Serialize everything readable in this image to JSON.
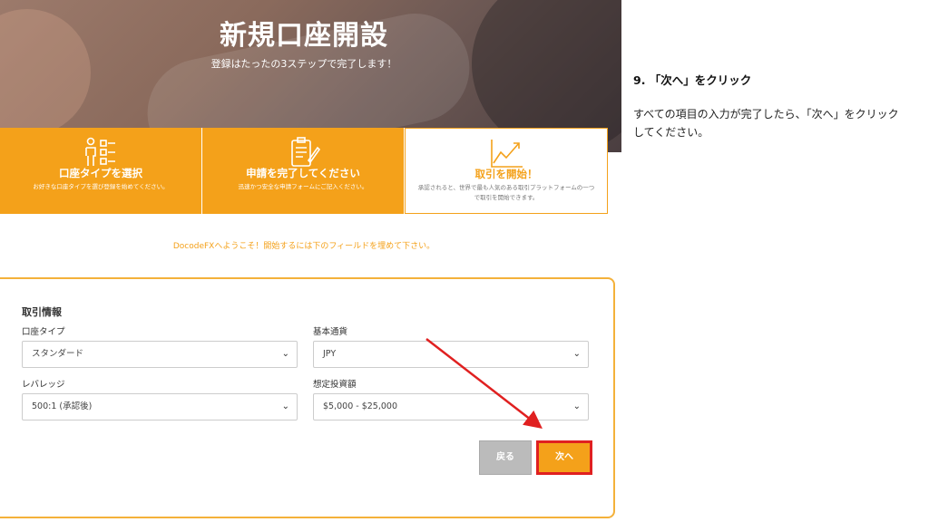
{
  "hero": {
    "title": "新規口座開設",
    "subtitle": "登録はたったの3ステップで完了します！"
  },
  "steps": [
    {
      "icon": "person-list-icon",
      "title": "口座タイプを選択",
      "desc": "お好きな口座タイプを選び登録を始めてください。",
      "active": false
    },
    {
      "icon": "clipboard-pen-icon",
      "title": "申請を完了してください",
      "desc": "迅速かつ安全な申請フォームにご記入ください。",
      "active": false
    },
    {
      "icon": "growth-chart-icon",
      "title": "取引を開始！",
      "desc": "承認されると、世界で最も人気のある取引プラットフォームの一つで取引を開始できます。",
      "active": true
    }
  ],
  "welcome": "DocodeFXへようこそ！開始するには下のフィールドを埋めて下さい。",
  "form": {
    "section_title": "取引情報",
    "account_type": {
      "label": "口座タイプ",
      "value": "スタンダード"
    },
    "base_currency": {
      "label": "基本通貨",
      "value": "JPY"
    },
    "leverage": {
      "label": "レバレッジ",
      "value": "500:1 (承認後)"
    },
    "investment": {
      "label": "想定投資額",
      "value": "$5,000 - $25,000"
    },
    "back_label": "戻る",
    "next_label": "次へ"
  },
  "colors": {
    "accent": "#f4a11a",
    "highlight": "#e02020"
  },
  "instruction": {
    "title": "9. 「次へ」をクリック",
    "body": "すべての項目の入力が完了したら、「次へ」をクリックしてください。"
  }
}
